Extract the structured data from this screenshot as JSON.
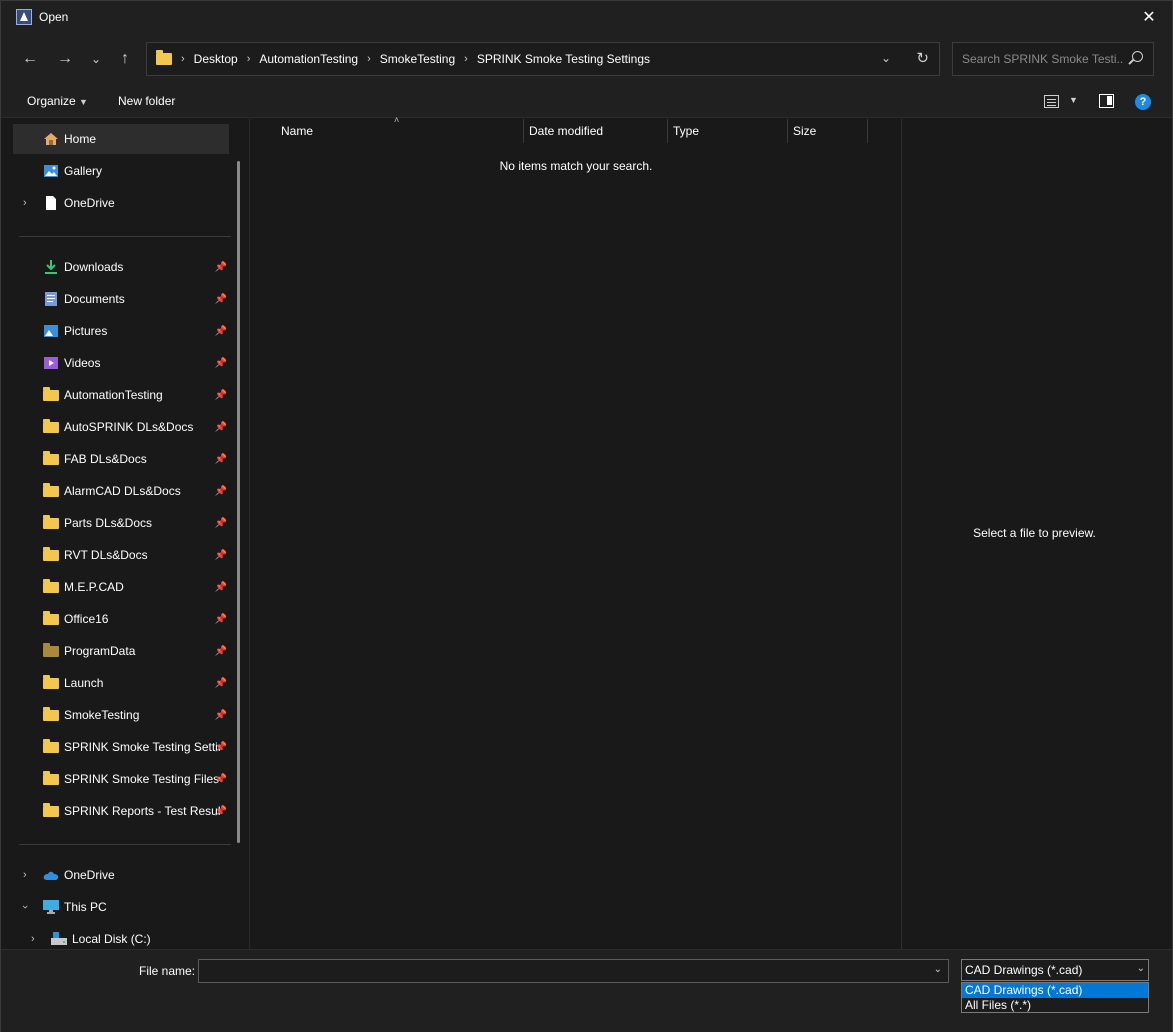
{
  "window": {
    "title": "Open"
  },
  "nav": {
    "breadcrumb": [
      "Desktop",
      "AutomationTesting",
      "SmokeTesting",
      "SPRINK Smoke Testing Settings"
    ],
    "search_placeholder": "Search SPRINK Smoke Testi..."
  },
  "commands": {
    "organize": "Organize",
    "new_folder": "New folder"
  },
  "sidebar": {
    "top_items": [
      {
        "label": "Home",
        "icon": "home-icon"
      },
      {
        "label": "Gallery",
        "icon": "gallery-icon"
      },
      {
        "label": "OneDrive",
        "icon": "document-icon"
      }
    ],
    "quick_access": [
      {
        "label": "Downloads",
        "icon": "download-icon"
      },
      {
        "label": "Documents",
        "icon": "documents-icon"
      },
      {
        "label": "Pictures",
        "icon": "pictures-icon"
      },
      {
        "label": "Videos",
        "icon": "videos-icon"
      },
      {
        "label": "AutomationTesting",
        "icon": "folder-icon"
      },
      {
        "label": "AutoSPRINK DLs&Docs",
        "icon": "folder-icon"
      },
      {
        "label": "FAB DLs&Docs",
        "icon": "folder-icon"
      },
      {
        "label": "AlarmCAD DLs&Docs",
        "icon": "folder-icon"
      },
      {
        "label": "Parts DLs&Docs",
        "icon": "folder-icon"
      },
      {
        "label": "RVT DLs&Docs",
        "icon": "folder-icon"
      },
      {
        "label": "M.E.P.CAD",
        "icon": "folder-icon"
      },
      {
        "label": "Office16",
        "icon": "folder-icon"
      },
      {
        "label": "ProgramData",
        "icon": "folder-icon"
      },
      {
        "label": "Launch",
        "icon": "folder-icon"
      },
      {
        "label": "SmokeTesting",
        "icon": "folder-icon"
      },
      {
        "label": "SPRINK Smoke Testing Settin",
        "icon": "folder-icon"
      },
      {
        "label": "SPRINK Smoke Testing Files",
        "icon": "folder-icon"
      },
      {
        "label": "SPRINK Reports - Test Result:",
        "icon": "folder-icon"
      }
    ],
    "bottom_items": [
      {
        "label": "OneDrive",
        "icon": "cloud-icon"
      },
      {
        "label": "This PC",
        "icon": "computer-icon"
      },
      {
        "label": "Local Disk (C:)",
        "icon": "drive-icon"
      }
    ]
  },
  "filelist": {
    "columns": [
      "Name",
      "Date modified",
      "Type",
      "Size"
    ],
    "empty_message": "No items match your search."
  },
  "preview": {
    "message": "Select a file to preview."
  },
  "footer": {
    "filename_label": "File name:",
    "filename_value": "",
    "filetype_selected": "CAD Drawings (*.cad)",
    "filetype_options": [
      "CAD Drawings (*.cad)",
      "All Files (*.*)"
    ]
  },
  "colors": {
    "accent": "#0078d7",
    "folder": "#f3c64d",
    "background": "#191919"
  }
}
